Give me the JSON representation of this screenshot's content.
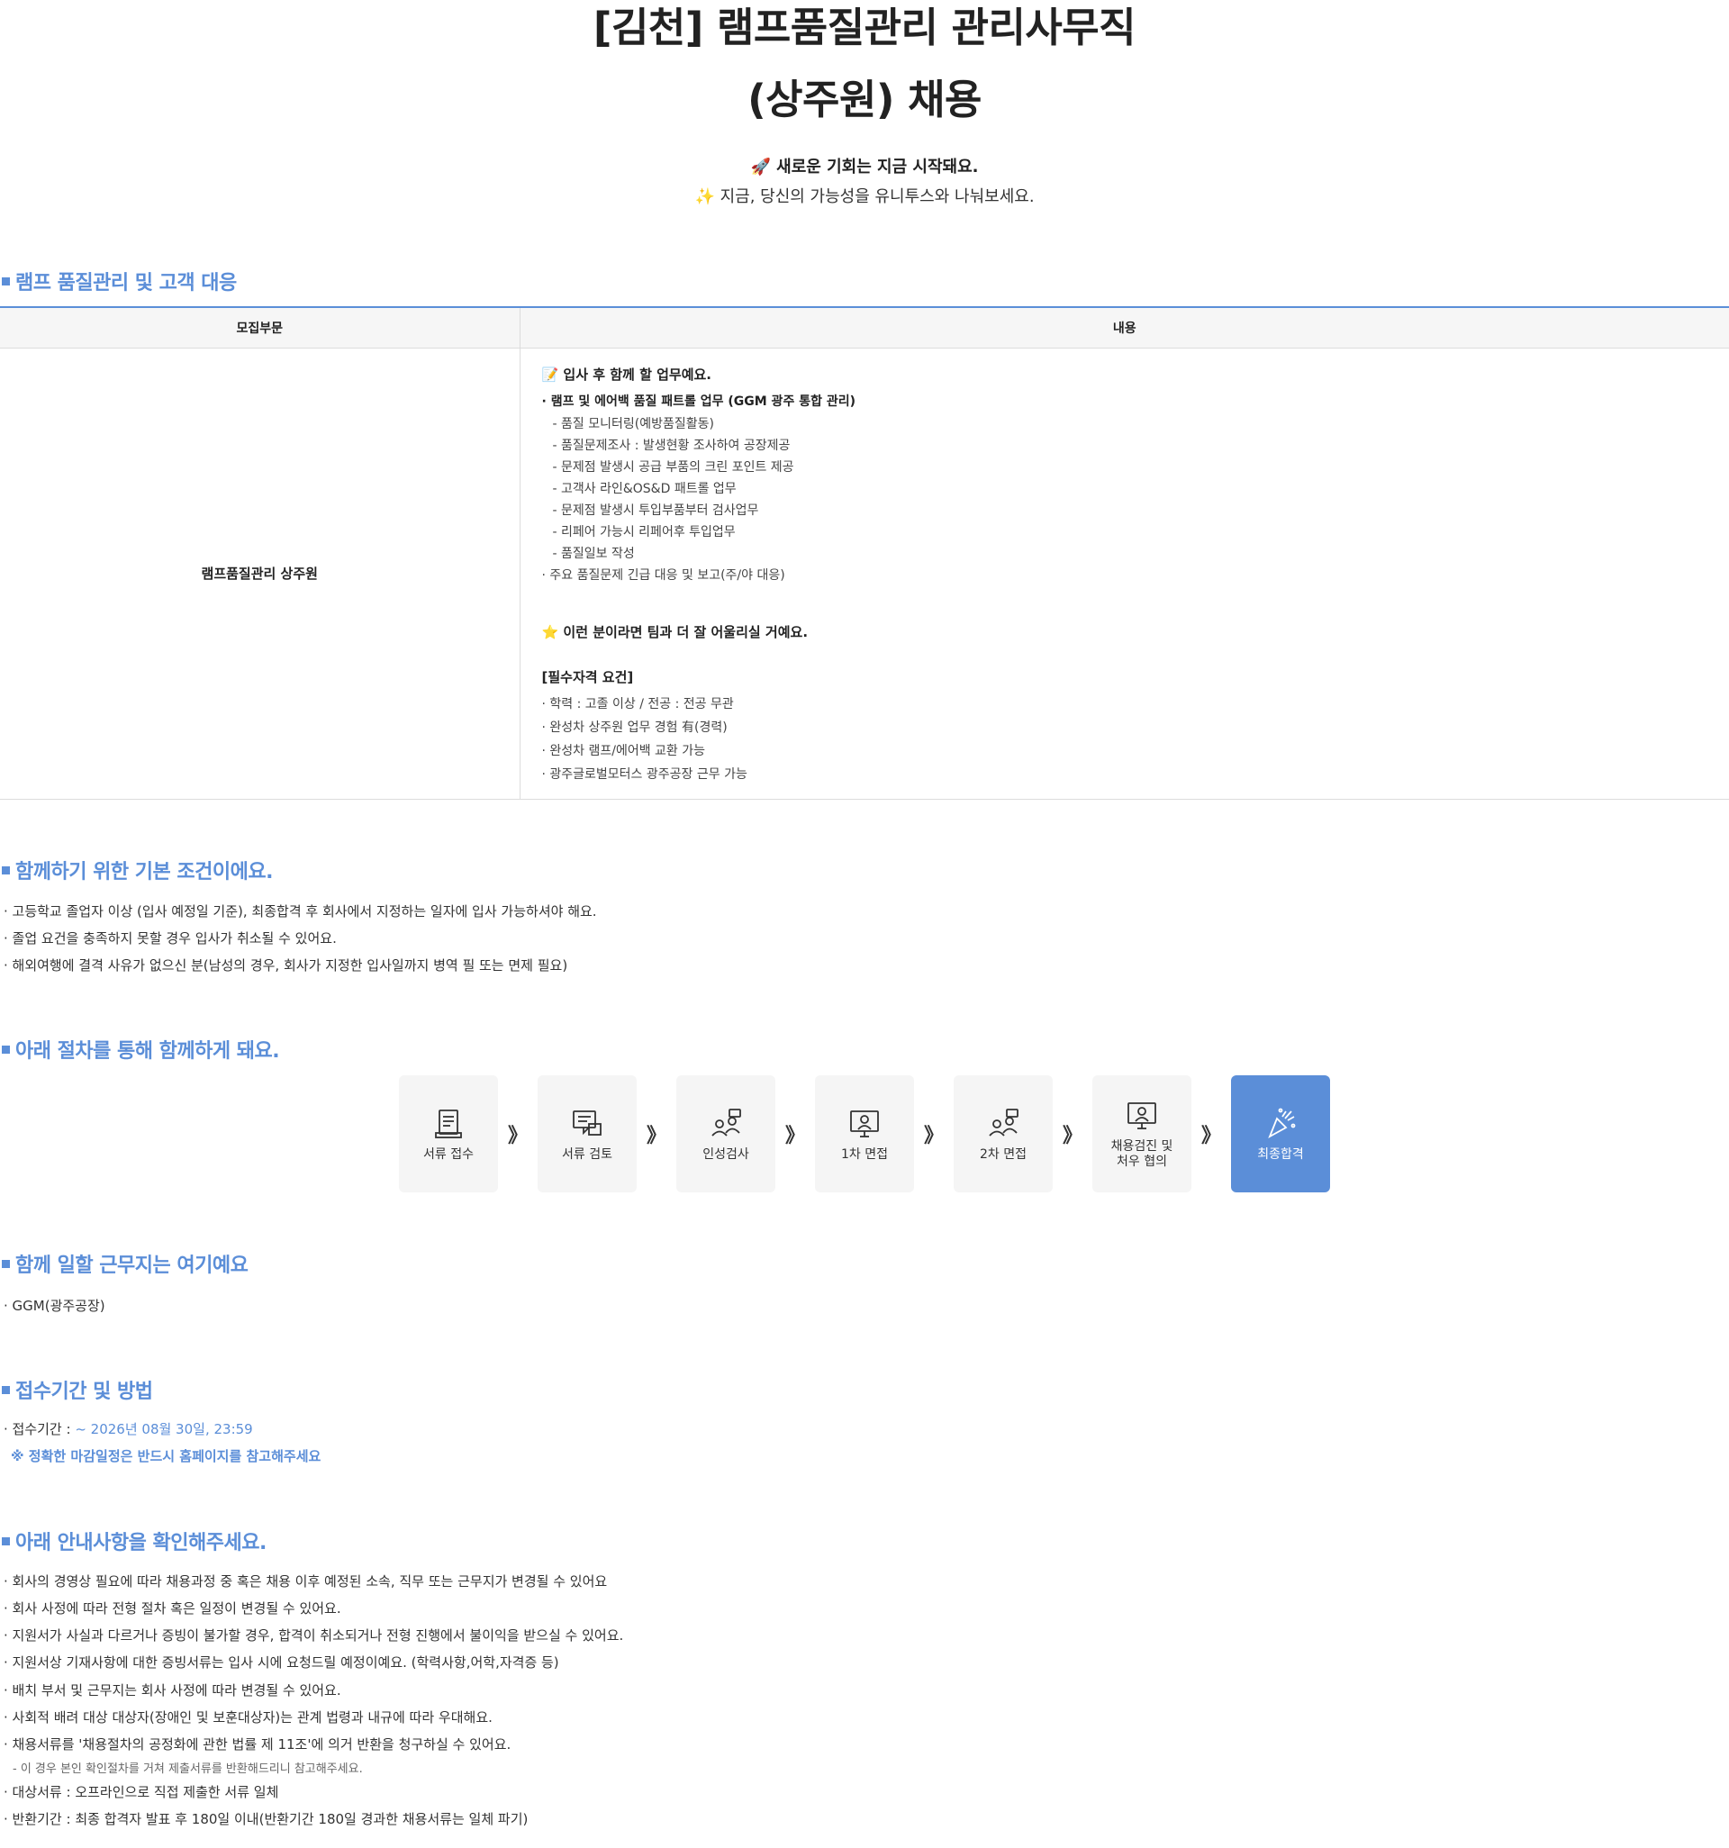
{
  "header": {
    "title_line1": "[김천] 램프품질관리 관리사무직",
    "title_line2": "(상주원) 채용",
    "tagline1": "🚀 새로운 기회는 지금 시작돼요.",
    "tagline2": "✨ 지금, 당신의 가능성을 유니투스와 나눠보세요."
  },
  "section1": {
    "heading": "램프 품질관리 및 고객 대응",
    "col_dept": "모집부문",
    "col_content": "내용",
    "dept": "램프품질관리 상주원",
    "duties_heading": "📝 입사 후 함께 할 업무예요.",
    "duties_main": "· 램프 및 에어백 품질 패트롤 업무 (GGM 광주 통합 관리)",
    "duties_sub": [
      "- 품질 모니터링(예방품질활동)",
      "- 품질문제조사 : 발생현황 조사하여 공장제공",
      "- 문제점 발생시 공급 부품의 크린 포인트 제공",
      "- 고객사 라인&OS&D 패트롤 업무",
      "- 문제점 발생시 투입부품부터 검사업무",
      "- 리페어 가능시 리페어후 투입업무",
      "- 품질일보 작성"
    ],
    "duties_extra": "· 주요 품질문제 긴급 대응 및 보고(주/야 대응)",
    "fit_heading": "⭐ 이런 분이라면 팀과 더 잘 어울리실 거예요.",
    "req_heading": "[필수자격 요건]",
    "req_items": [
      "· 학력 : 고졸 이상 / 전공 : 전공 무관",
      "· 완성차 상주원 업무 경험 有(경력)",
      "· 완성차 램프/에어백 교환 가능",
      "· 광주글로벌모터스 광주공장 근무 가능"
    ]
  },
  "section2": {
    "heading": "함께하기 위한 기본 조건이에요.",
    "items": [
      "· 고등학교 졸업자 이상 (입사 예정일 기준), 최종합격 후 회사에서 지정하는 일자에 입사 가능하셔야 해요.",
      "· 졸업 요건을 충족하지 못할 경우 입사가 취소될 수 있어요.",
      "· 해외여행에 결격 사유가 없으신 분(남성의 경우, 회사가 지정한 입사일까지 병역 필 또는 면제 필요)"
    ]
  },
  "section3": {
    "heading": "아래 절차를 통해 함께하게 돼요.",
    "steps": [
      "서류 접수",
      "서류 검토",
      "인성검사",
      "1차 면접",
      "2차 면접",
      "채용검진 및\n처우 협의",
      "최종합격"
    ],
    "arrow": "》",
    "active_color": "#5b8ed8"
  },
  "section4": {
    "heading": "함께 일할 근무지는 여기예요",
    "item": "· GGM(광주공장)"
  },
  "section5": {
    "heading": "접수기간 및 방법",
    "period_label": "· 접수기간 : ",
    "period_value": "~ 2026년 08월 30일, 23:59",
    "note": "※ 정확한 마감일정은 반드시 홈페이지를 참고해주세요"
  },
  "section6": {
    "heading": "아래 안내사항을 확인해주세요.",
    "items": [
      "· 회사의 경영상 필요에 따라 채용과정 중 혹은 채용 이후 예정된 소속, 직무 또는 근무지가 변경될 수 있어요",
      "· 회사 사정에 따라 전형 절차 혹은 일정이 변경될 수 있어요.",
      "· 지원서가 사실과 다르거나 증빙이 불가할 경우, 합격이 취소되거나 전형 진행에서 불이익을 받으실 수 있어요.",
      "· 지원서상 기재사항에 대한 증빙서류는 입사 시에 요청드릴 예정이예요. (학력사항,어학,자격증 등)",
      "· 배치 부서 및 근무지는 회사 사정에 따라 변경될 수 있어요.",
      "· 사회적 배려 대상 대상자(장애인 및 보훈대상자)는 관계 법령과 내규에 따라 우대해요.",
      "· 채용서류를 '채용절차의 공정화에 관한 법률 제 11조'에 의거 반환을 청구하실 수 있어요."
    ],
    "sub_note": "- 이 경우 본인 확인절차를 거쳐 제출서류를 반환해드리니 참고해주세요.",
    "tail_items": [
      "· 대상서류 : 오프라인으로 직접 제출한 서류 일체",
      "· 반환기간 : 최종 합격자 발표 후 180일 이내(반환기간 180일 경과한 채용서류는 일체 파기)"
    ]
  }
}
